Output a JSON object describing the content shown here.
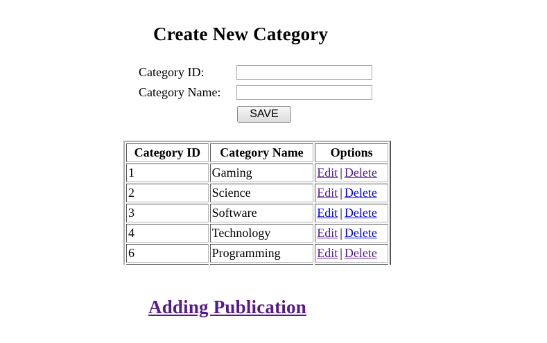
{
  "page_title": "Create New Category",
  "form": {
    "id_label": "Category ID:",
    "id_value": "",
    "name_label": "Category Name:",
    "name_value": "",
    "save_label": "SAVE"
  },
  "table": {
    "headers": [
      "Category ID",
      "Category Name",
      "Options"
    ],
    "rows": [
      {
        "id": "1",
        "name": "Gaming",
        "edit": "Edit",
        "delete": "Delete"
      },
      {
        "id": "2",
        "name": "Science",
        "edit": "Edit",
        "delete": "Delete"
      },
      {
        "id": "3",
        "name": "Software",
        "edit": "Edit",
        "delete": "Delete"
      },
      {
        "id": "4",
        "name": "Technology",
        "edit": "Edit",
        "delete": "Delete"
      },
      {
        "id": "6",
        "name": "Programming",
        "edit": "Edit",
        "delete": "Delete"
      },
      {
        "id": "",
        "name": "",
        "edit": "",
        "delete": ""
      }
    ],
    "separator": "|"
  },
  "footer_link": "Adding Publication",
  "colors": {
    "link": "#0000ee",
    "visited_link": "#551a8b"
  }
}
